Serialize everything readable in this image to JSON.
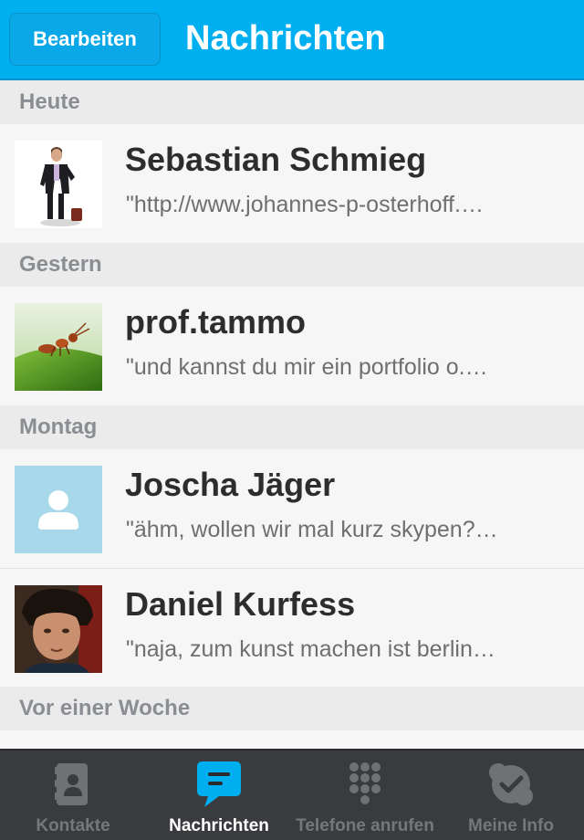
{
  "navbar": {
    "edit_label": "Bearbeiten",
    "title": "Nachrichten"
  },
  "sections": [
    {
      "header": "Heute",
      "conversations": [
        {
          "name": "Sebastian Schmieg",
          "preview": "\"http://www.johannes-p-osterhoff.…",
          "avatar": "photo-man-suit"
        }
      ]
    },
    {
      "header": "Gestern",
      "conversations": [
        {
          "name": "prof.tammo",
          "preview": "\"und kannst du mir ein portfolio o.…",
          "avatar": "photo-ant-on-grass"
        }
      ]
    },
    {
      "header": "Montag",
      "conversations": [
        {
          "name": "Joscha Jäger",
          "preview": "\"ähm, wollen wir mal kurz skypen?…",
          "avatar": "default-person-icon"
        },
        {
          "name": "Daniel Kurfess",
          "preview": "\"naja, zum kunst machen ist berlin…",
          "avatar": "photo-face"
        }
      ]
    },
    {
      "header": "Vor einer Woche",
      "conversations": []
    }
  ],
  "tabbar": {
    "tabs": [
      {
        "label": "Kontakte",
        "icon": "contacts-book-icon",
        "active": false
      },
      {
        "label": "Nachrichten",
        "icon": "chat-bubble-icon",
        "active": true
      },
      {
        "label": "Telefone anrufen",
        "icon": "dialpad-icon",
        "active": false
      },
      {
        "label": "Meine Info",
        "icon": "skype-check-icon",
        "active": false
      }
    ]
  },
  "colors": {
    "accent": "#00aff0",
    "tabbar_bg": "#3a3b3f",
    "section_bg": "#ebebeb"
  }
}
